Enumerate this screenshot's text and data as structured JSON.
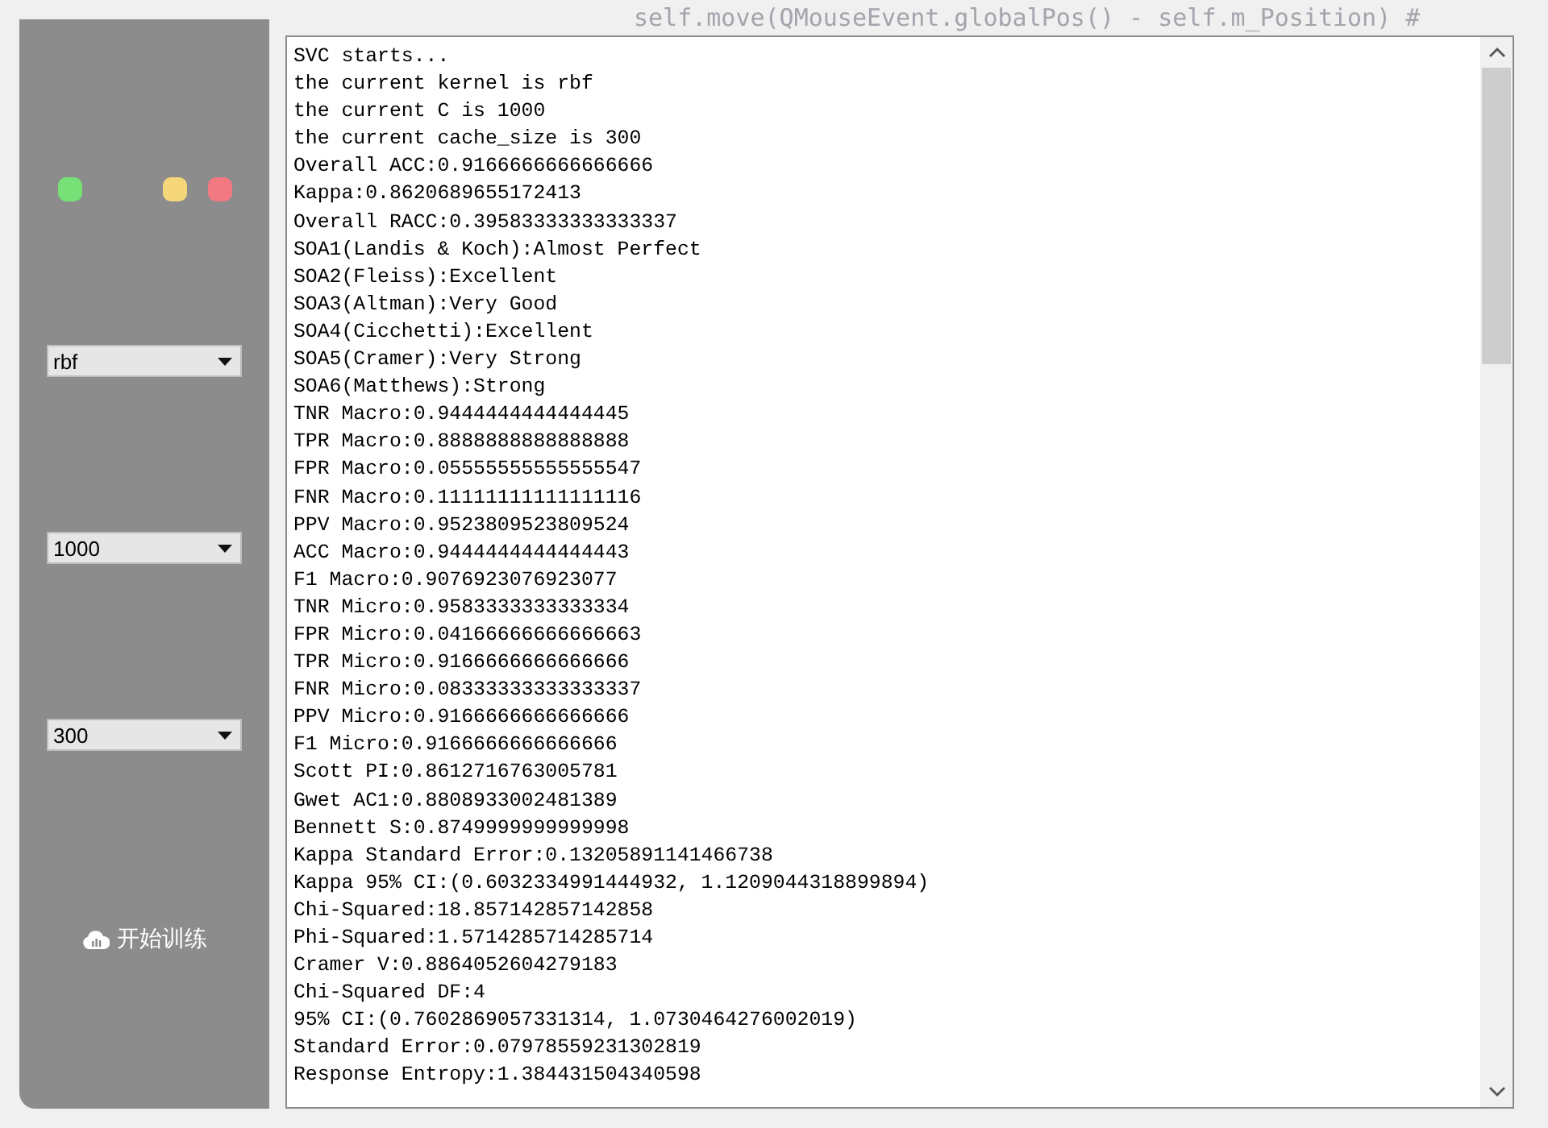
{
  "background_editor": {
    "code_line": "self.move(QMouseEvent.globalPos() - self.m_Position)  #"
  },
  "sidebar": {
    "window_dots": [
      {
        "color": "#77e077"
      },
      {
        "color": "#f5d77a"
      },
      {
        "color": "#f27882"
      }
    ],
    "dropdowns": [
      {
        "value": "rbf"
      },
      {
        "value": "1000"
      },
      {
        "value": "300"
      }
    ],
    "train_button": {
      "label": "开始训练"
    }
  },
  "output": {
    "lines": [
      "SVC starts...",
      "the current kernel is rbf",
      "the current C is 1000",
      "the current cache_size is 300",
      "Overall ACC:0.9166666666666666",
      "Kappa:0.8620689655172413",
      "Overall RACC:0.39583333333333337",
      "SOA1(Landis & Koch):Almost Perfect",
      "SOA2(Fleiss):Excellent",
      "SOA3(Altman):Very Good",
      "SOA4(Cicchetti):Excellent",
      "SOA5(Cramer):Very Strong",
      "SOA6(Matthews):Strong",
      "TNR Macro:0.9444444444444445",
      "TPR Macro:0.8888888888888888",
      "FPR Macro:0.05555555555555547",
      "FNR Macro:0.11111111111111116",
      "PPV Macro:0.9523809523809524",
      "ACC Macro:0.9444444444444443",
      "F1 Macro:0.9076923076923077",
      "TNR Micro:0.9583333333333334",
      "FPR Micro:0.04166666666666663",
      "TPR Micro:0.9166666666666666",
      "FNR Micro:0.08333333333333337",
      "PPV Micro:0.9166666666666666",
      "F1 Micro:0.9166666666666666",
      "Scott PI:0.8612716763005781",
      "Gwet AC1:0.8808933002481389",
      "Bennett S:0.8749999999999998",
      "Kappa Standard Error:0.13205891141466738",
      "Kappa 95% CI:(0.6032334991444932, 1.1209044318899894)",
      "Chi-Squared:18.857142857142858",
      "Phi-Squared:1.5714285714285714",
      "Cramer V:0.8864052604279183",
      "Chi-Squared DF:4",
      "95% CI:(0.7602869057331314, 1.0730464276002019)",
      "Standard Error:0.07978559231302819",
      "Response Entropy:1.384431504340598"
    ]
  }
}
